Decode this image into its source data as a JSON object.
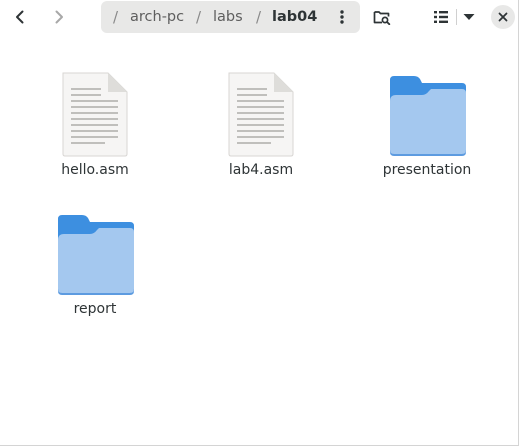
{
  "toolbar": {
    "back_icon": "chevron-left-icon",
    "forward_icon": "chevron-right-icon",
    "path_menu_icon": "vertical-dots-icon",
    "search_icon": "folder-search-icon",
    "view_icon": "list-view-icon",
    "view_options_icon": "triangle-down-icon",
    "close_icon": "close-icon"
  },
  "pathbar": {
    "separator": "/",
    "segments": [
      {
        "label": "arch-pc",
        "current": false
      },
      {
        "label": "labs",
        "current": false
      },
      {
        "label": "lab04",
        "current": true
      }
    ]
  },
  "files": [
    {
      "name": "hello.asm",
      "kind": "text-file"
    },
    {
      "name": "lab4.asm",
      "kind": "text-file"
    },
    {
      "name": "presentation",
      "kind": "folder"
    },
    {
      "name": "report",
      "kind": "folder"
    }
  ],
  "colors": {
    "folder_back": "#3d8fe0",
    "folder_front": "#a4c8ef",
    "file_page": "#f6f5f4",
    "file_lines": "#c0bfbc"
  }
}
